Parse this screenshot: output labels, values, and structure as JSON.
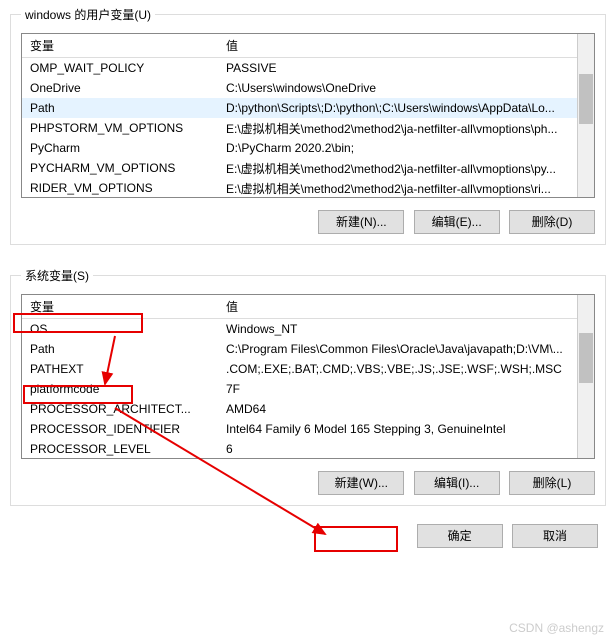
{
  "user_vars": {
    "title": "windows 的用户变量(U)",
    "header_var": "变量",
    "header_val": "值",
    "rows": [
      {
        "name": "OMP_WAIT_POLICY",
        "value": "PASSIVE"
      },
      {
        "name": "OneDrive",
        "value": "C:\\Users\\windows\\OneDrive"
      },
      {
        "name": "Path",
        "value": "D:\\python\\Scripts\\;D:\\python\\;C:\\Users\\windows\\AppData\\Lo..."
      },
      {
        "name": "PHPSTORM_VM_OPTIONS",
        "value": "E:\\虚拟机相关\\method2\\method2\\ja-netfilter-all\\vmoptions\\ph..."
      },
      {
        "name": "PyCharm",
        "value": "D:\\PyCharm 2020.2\\bin;"
      },
      {
        "name": "PYCHARM_VM_OPTIONS",
        "value": "E:\\虚拟机相关\\method2\\method2\\ja-netfilter-all\\vmoptions\\py..."
      },
      {
        "name": "RIDER_VM_OPTIONS",
        "value": "E:\\虚拟机相关\\method2\\method2\\ja-netfilter-all\\vmoptions\\ri..."
      }
    ],
    "btn_new": "新建(N)...",
    "btn_edit": "编辑(E)...",
    "btn_delete": "删除(D)"
  },
  "sys_vars": {
    "title": "系统变量(S)",
    "header_var": "变量",
    "header_val": "值",
    "rows": [
      {
        "name": "OS",
        "value": "Windows_NT"
      },
      {
        "name": "Path",
        "value": "C:\\Program Files\\Common Files\\Oracle\\Java\\javapath;D:\\VM\\..."
      },
      {
        "name": "PATHEXT",
        "value": ".COM;.EXE;.BAT;.CMD;.VBS;.VBE;.JS;.JSE;.WSF;.WSH;.MSC"
      },
      {
        "name": "platformcode",
        "value": "7F"
      },
      {
        "name": "PROCESSOR_ARCHITECT...",
        "value": "AMD64"
      },
      {
        "name": "PROCESSOR_IDENTIFIER",
        "value": "Intel64 Family 6 Model 165 Stepping 3, GenuineIntel"
      },
      {
        "name": "PROCESSOR_LEVEL",
        "value": "6"
      }
    ],
    "btn_new": "新建(W)...",
    "btn_edit": "编辑(I)...",
    "btn_delete": "删除(L)"
  },
  "dialog": {
    "btn_ok": "确定",
    "btn_cancel": "取消"
  },
  "watermark": "CSDN @ashengz"
}
